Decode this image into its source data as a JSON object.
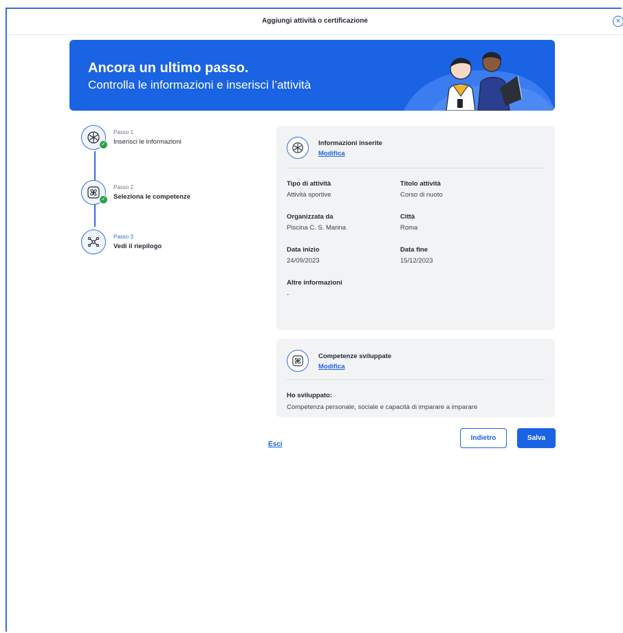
{
  "modal": {
    "title": "Aggiungi attività o certificazione",
    "close_icon": "close-circle-icon"
  },
  "banner": {
    "title": "Ancora un ultimo passo.",
    "subtitle": "Controlla le informazioni e inserisci l’attività",
    "background_color": "#1a63e3",
    "illustration": "two-people-illustration"
  },
  "stepper": {
    "steps": [
      {
        "kicker": "Passo 1",
        "label": "Inserisci le informazioni",
        "status": "completed",
        "icon": "snowflake-icon"
      },
      {
        "kicker": "Passo 2",
        "label": "Seleziona le competenze",
        "status": "completed",
        "icon": "pinwheel-icon"
      },
      {
        "kicker": "Passo 3",
        "label": "Vedi il riepilogo",
        "status": "current",
        "icon": "network-icon"
      }
    ]
  },
  "info_card": {
    "title": "Informazioni inserite",
    "edit_label": "Modifica",
    "fields": {
      "tipo_label": "Tipo di attività",
      "tipo_value": "Attività sportive",
      "titolo_label": "Titolo attività",
      "titolo_value": "Corso di nuoto",
      "org_label": "Organizzata da",
      "org_value": "Piscina C. S. Marina",
      "citta_label": "Città",
      "citta_value": "Roma",
      "inizio_label": "Data inizio",
      "inizio_value": "24/09/2023",
      "fine_label": "Data fine",
      "fine_value": "15/12/2023",
      "altre_label": "Altre informazioni",
      "altre_value": "-"
    }
  },
  "skills_card": {
    "title": "Competenze sviluppate",
    "edit_label": "Modifica",
    "developed_label": "Ho sviluppato:",
    "developed_value": "Competenza personale, sociale e capacità di imparare a imparare"
  },
  "actions": {
    "exit_label": "Esci",
    "back_label": "Indietro",
    "save_label": "Salva"
  },
  "colors": {
    "primary": "#1a63e3",
    "success": "#2aa34a",
    "card_bg": "#f2f3f5"
  }
}
